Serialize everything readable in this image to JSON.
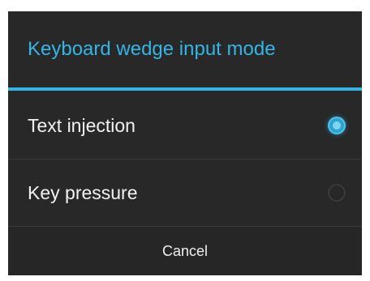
{
  "dialog": {
    "title": "Keyboard wedge input mode",
    "options": [
      {
        "label": "Text injection",
        "selected": true
      },
      {
        "label": "Key pressure",
        "selected": false
      }
    ],
    "cancel_label": "Cancel"
  },
  "colors": {
    "accent": "#33b5e5",
    "background": "#282828",
    "text": "#f2f2f2"
  }
}
